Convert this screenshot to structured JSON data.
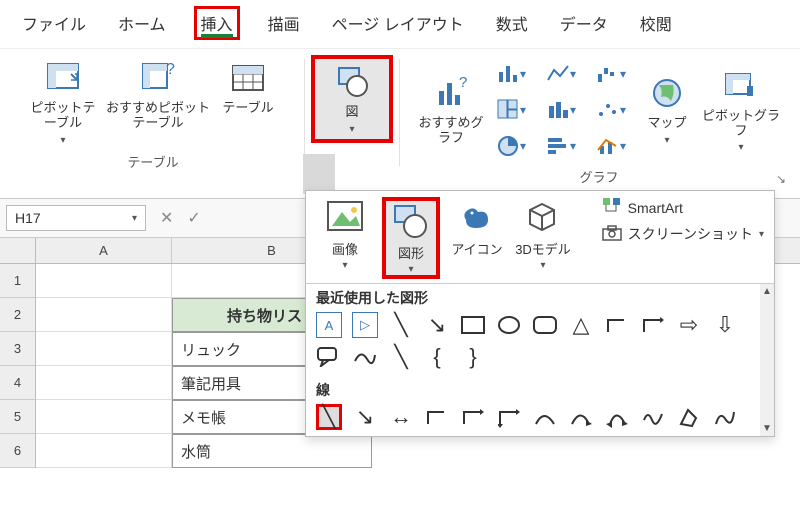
{
  "menubar": {
    "tabs": [
      "ファイル",
      "ホーム",
      "挿入",
      "描画",
      "ページ レイアウト",
      "数式",
      "データ",
      "校閲"
    ],
    "active": "挿入"
  },
  "ribbon": {
    "tables": {
      "label": "テーブル",
      "pivot": "ピボットテーブル",
      "pivot_suggest": "おすすめピボットテーブル",
      "table": "テーブル"
    },
    "illustrations": {
      "button": "図"
    },
    "charts": {
      "label": "グラフ",
      "suggest": "おすすめグラフ",
      "map": "マップ",
      "pivotchart": "ピボットグラフ"
    }
  },
  "shapesPanel": {
    "image": "画像",
    "shapes": "図形",
    "icons": "アイコン",
    "model3d": "3Dモデル",
    "smartart": "SmartArt",
    "screenshot": "スクリーンショット",
    "recent_label": "最近使用した図形",
    "lines_label": "線"
  },
  "cellRef": "H17",
  "sheet": {
    "cols": [
      "A",
      "B"
    ],
    "rows": [
      "1",
      "2",
      "3",
      "4",
      "5",
      "6"
    ],
    "B2": "持ち物リスト",
    "B3": "リュック",
    "B4": "筆記用具",
    "B5": "メモ帳",
    "B6": "水筒"
  }
}
